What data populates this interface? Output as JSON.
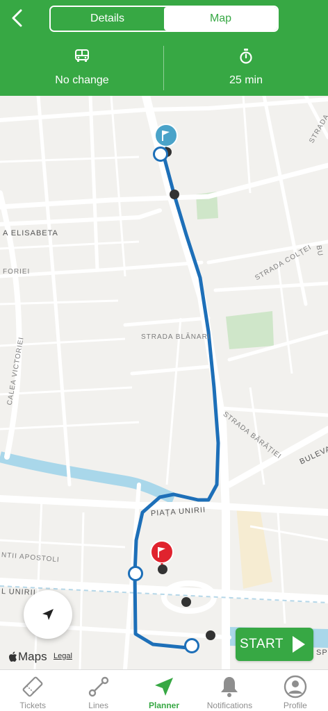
{
  "header": {
    "tabs": [
      {
        "label": "Details",
        "active": false
      },
      {
        "label": "Map",
        "active": true
      }
    ]
  },
  "summary": {
    "change_label": "No change",
    "change_icon": "bus-icon",
    "duration_label": "25 min",
    "duration_icon": "stopwatch-icon"
  },
  "map": {
    "streets": [
      "A ELISABETA",
      "FORIEI",
      "CALEA VICTORIEI",
      "STRADA BLĂNARI",
      "STRADA COLȚEI",
      "STRADA",
      "BU",
      "STRADA BĂRĂȚIEI",
      "BULEVA",
      "PIAȚA UNIRII",
      "NTII APOSTOLI",
      "L UNIRII",
      "SP"
    ],
    "attribution": "Maps",
    "legal": "Legal",
    "start_label": "START"
  },
  "tabbar": {
    "tabs": [
      {
        "label": "Tickets",
        "icon": "ticket-icon",
        "active": false
      },
      {
        "label": "Lines",
        "icon": "route-icon",
        "active": false
      },
      {
        "label": "Planner",
        "icon": "navigation-arrow-icon",
        "active": true
      },
      {
        "label": "Notifications",
        "icon": "bell-icon",
        "active": false
      },
      {
        "label": "Profile",
        "icon": "user-icon",
        "active": false
      }
    ]
  },
  "colors": {
    "brand_green": "#37a844",
    "route_blue": "#1d6fb8",
    "destination_red": "#e0232e",
    "origin_teal": "#4aa3c9"
  }
}
